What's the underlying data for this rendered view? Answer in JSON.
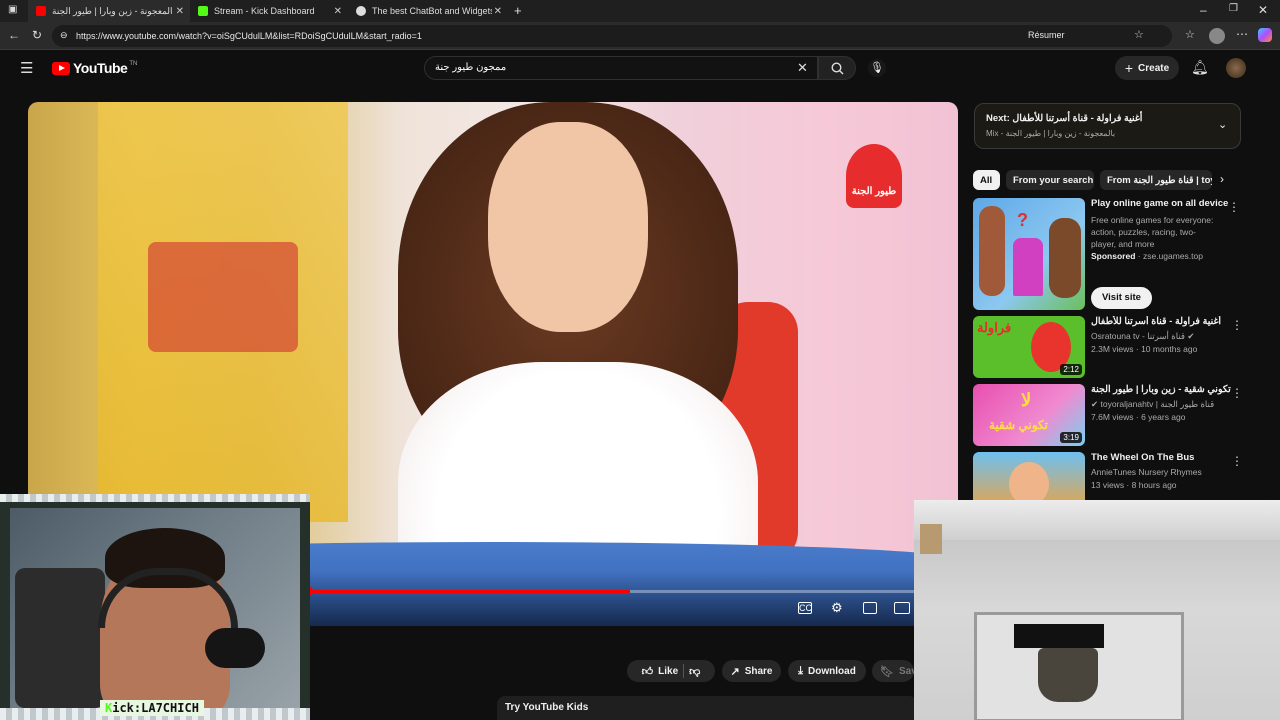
{
  "browser": {
    "tabs": [
      {
        "title": "بالمعجونة - زين وبارا | طيور الجنة",
        "favicon_color": "#ff0000"
      },
      {
        "title": "Stream - Kick Dashboard",
        "favicon_color": "#53fc18"
      },
      {
        "title": "The best ChatBot and Widgets fo",
        "favicon_color": "#dddddd"
      }
    ],
    "url": "https://www.youtube.com/watch?v=oiSgCUdulLM&list=RDoiSgCUdulLM&start_radio=1",
    "resume_label": "Résumer"
  },
  "youtube": {
    "logo_text": "YouTube",
    "logo_country": "TN",
    "search_value": "ممجون طيور جنة",
    "create_label": "Create"
  },
  "video": {
    "channel_watermark": "طيور الجنة",
    "progress_fraction": 0.52
  },
  "actions": {
    "like_label": "Like",
    "share_label": "Share",
    "download_label": "Download",
    "save_label": "Save"
  },
  "sidebar": {
    "next": {
      "prefix": "Next:",
      "title": "أغنية فراولة - قناة أسرتنا للأطفال",
      "subtitle": "Mix - بالمعجونة - زين وبارا | طيور الجنة"
    },
    "chips": [
      "All",
      "From your search",
      "From قناة طيور الجنة | toyor"
    ],
    "ad": {
      "title": "Play online game on all device",
      "desc": "Free online games for everyone: action, puzzles, racing, two-player, and more",
      "sponsored": "Sponsored",
      "domain": "· zse.ugames.top",
      "cta": "Visit site"
    },
    "recs": [
      {
        "title": "أغنية فراولة - قناة أسرتنا للأطفال",
        "channel": "Osratouna tv - قناة أسرتنا",
        "meta": "2.3M views · 10 months ago",
        "duration": "2:12",
        "color": "#5bbf2c"
      },
      {
        "title": "لا تكوني شقية - زين وبارا | طيور الجنة",
        "channel": "toyoraljanahtv | قناة طيور الجنة",
        "meta": "7.6M views · 6 years ago",
        "duration": "3:19",
        "color": "#e84fb0"
      },
      {
        "title": "The Wheel On The Bus",
        "channel": "AnnieTunes Nursery Rhymes",
        "meta": "13 views · 8 hours ago",
        "duration": "",
        "color": "#f0a23c"
      }
    ]
  },
  "overlay": {
    "kick_prefix": "K",
    "kick_handle": "ick:LA7CHICH"
  },
  "bottom": {
    "kids_label": "Try YouTube Kids"
  }
}
